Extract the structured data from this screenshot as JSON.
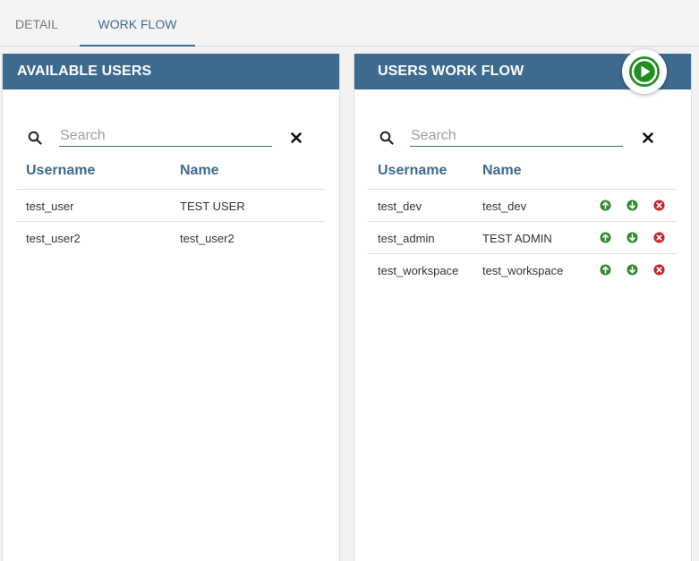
{
  "tabs": [
    {
      "label": "DETAIL",
      "active": false
    },
    {
      "label": "WORK FLOW",
      "active": true
    }
  ],
  "colors": {
    "accent": "#3d6a8f",
    "up_green": "#2e8b2e",
    "delete_red": "#c62828",
    "play_green": "#1f8f1f"
  },
  "available_users": {
    "title": "AVAILABLE USERS",
    "search": {
      "placeholder": "Search",
      "value": "",
      "search_icon": "search-icon",
      "clear_icon": "close-icon"
    },
    "columns": [
      "Username",
      "Name"
    ],
    "rows": [
      {
        "username": "test_user",
        "name": "TEST USER"
      },
      {
        "username": "test_user2",
        "name": "test_user2"
      }
    ]
  },
  "users_workflow": {
    "title": "USERS WORK FLOW",
    "run_icon": "play-circle-icon",
    "search": {
      "placeholder": "Search",
      "value": "",
      "search_icon": "search-icon",
      "clear_icon": "close-icon"
    },
    "columns": [
      "Username",
      "Name"
    ],
    "row_actions": [
      "arrow-up-circle-icon",
      "arrow-down-circle-icon",
      "remove-circle-icon"
    ],
    "rows": [
      {
        "username": "test_dev",
        "name": "test_dev"
      },
      {
        "username": "test_admin",
        "name": "TEST ADMIN"
      },
      {
        "username": "test_workspace",
        "name": "test_workspace"
      }
    ]
  }
}
